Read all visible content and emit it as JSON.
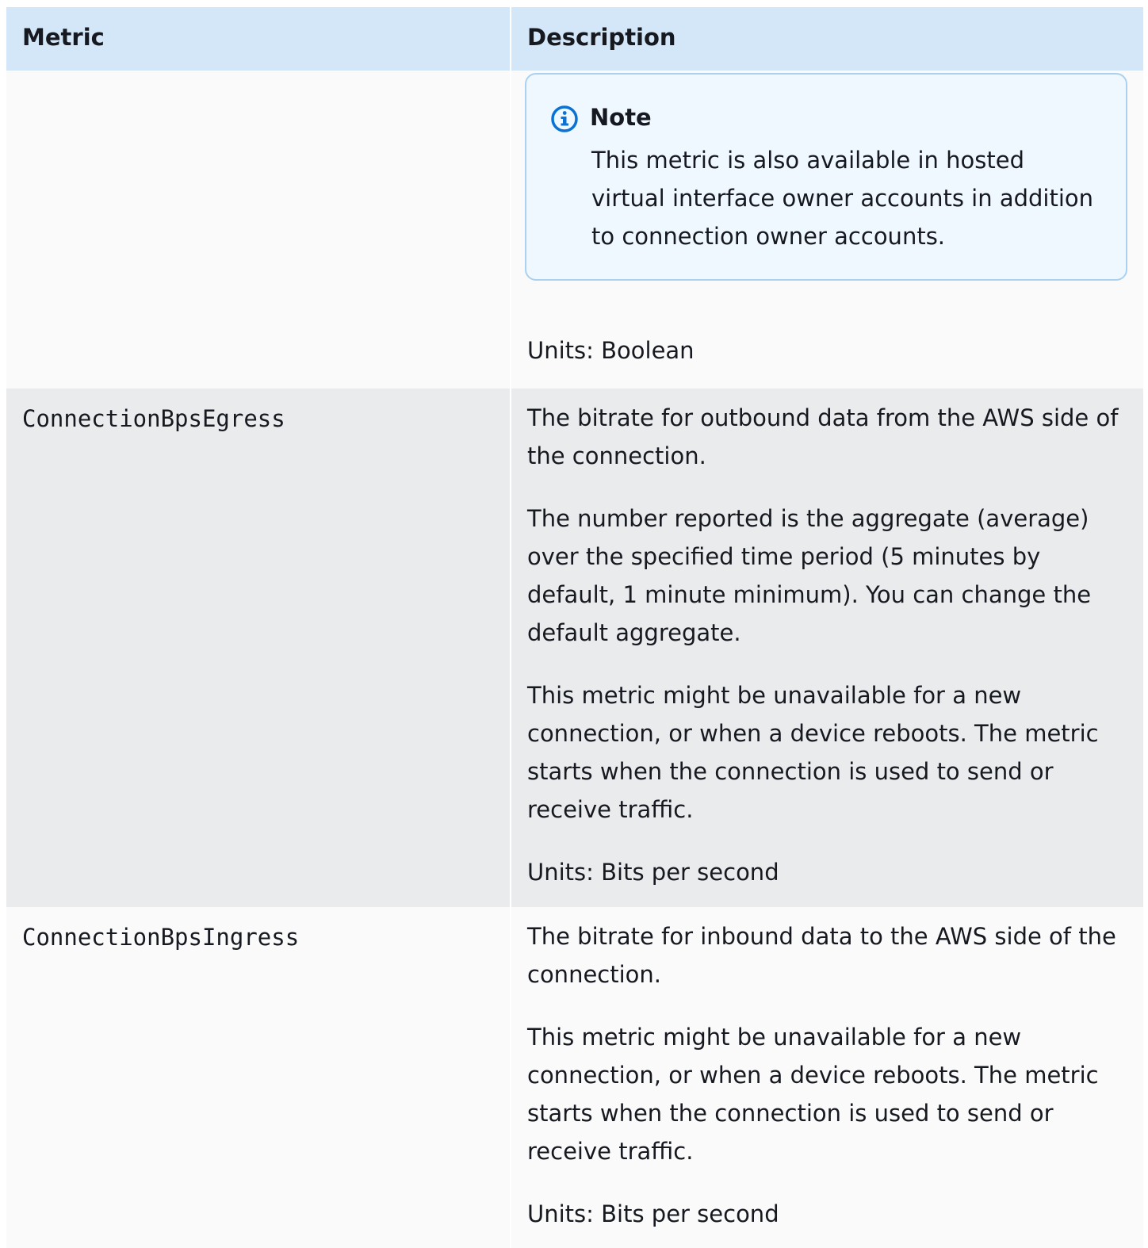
{
  "table": {
    "headers": {
      "metric": "Metric",
      "description": "Description"
    },
    "note": {
      "title": "Note",
      "body": "This metric is also available in hosted virtual interface owner accounts in addition to connection owner accounts."
    },
    "row0": {
      "units": "Units: Boolean"
    },
    "row1": {
      "metric": "ConnectionBpsEgress",
      "p1": "The bitrate for outbound data from the AWS side of the connection.",
      "p2": "The number reported is the aggregate (average) over the specified time period (5 minutes by default, 1 minute minimum). You can change the default aggregate.",
      "p3": "This metric might be unavailable for a new connection, or when a device reboots. The metric starts when the connection is used to send or receive traffic.",
      "units": "Units: Bits per second"
    },
    "row2": {
      "metric": "ConnectionBpsIngress",
      "p1": "The bitrate for inbound data to the AWS side of the connection.",
      "p2": "This metric might be unavailable for a new connection, or when a device reboots. The metric starts when the connection is used to send or receive traffic.",
      "units": "Units: Bits per second"
    }
  },
  "colors": {
    "header_bg": "#d4e7f8",
    "note_border": "#aad1f0",
    "note_bg": "#f0f8ff",
    "info_icon": "#0972d3"
  },
  "icons": {
    "note": "info-circle-icon"
  }
}
